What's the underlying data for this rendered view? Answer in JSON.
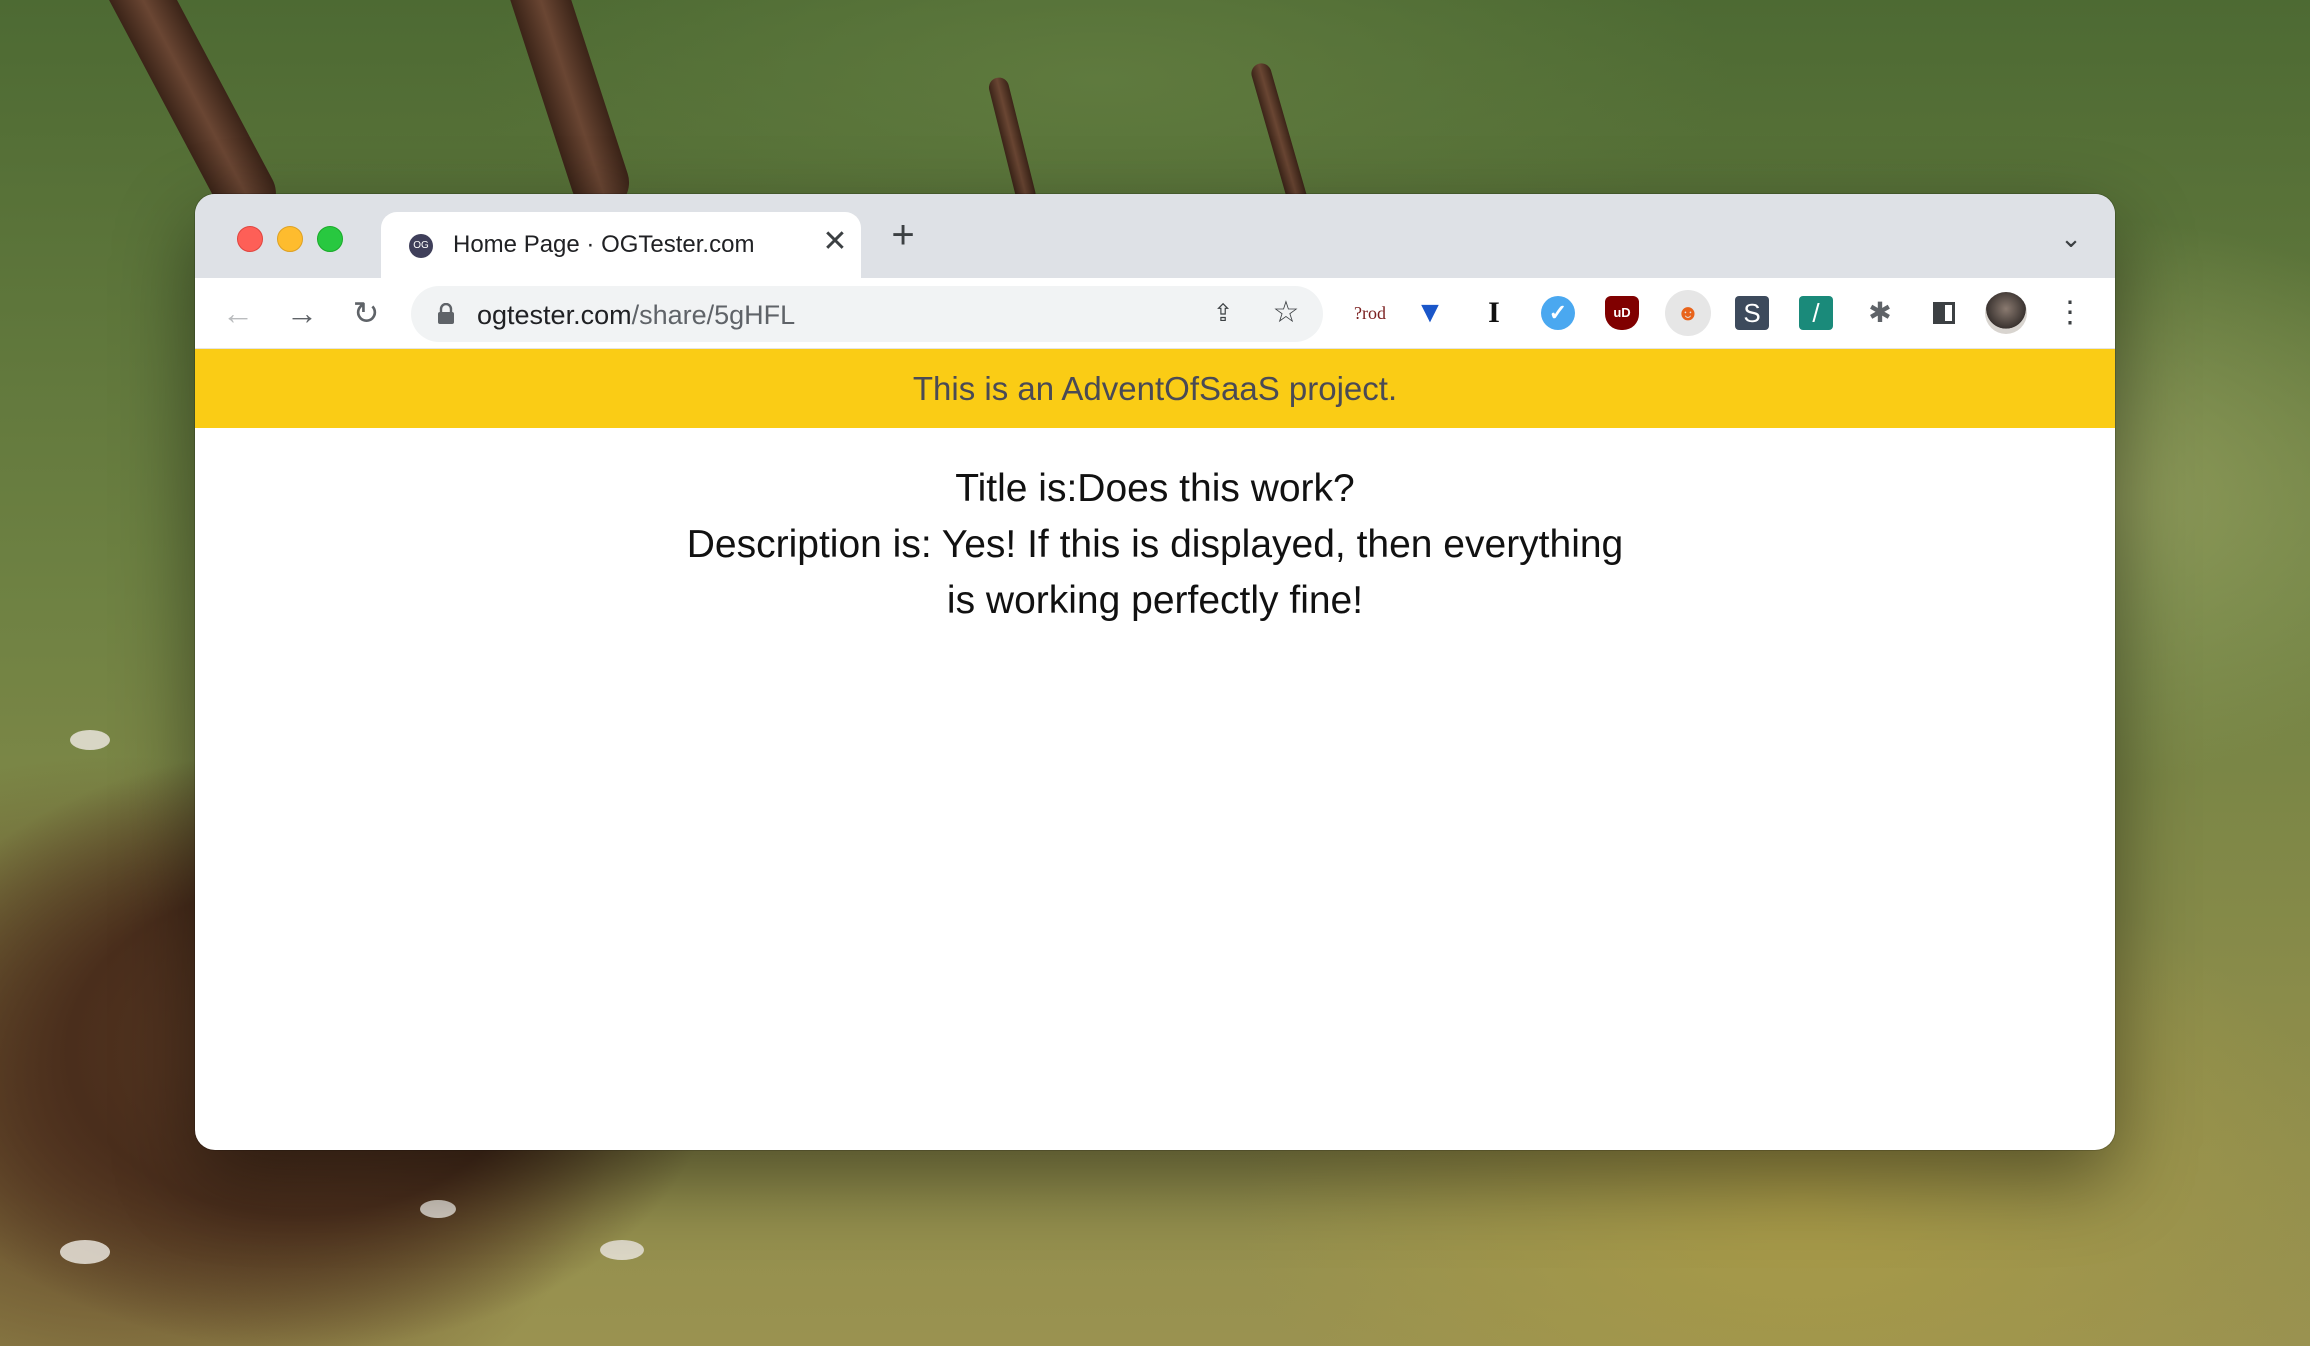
{
  "tab": {
    "favicon": "OG",
    "title": "Home Page · OGTester.com",
    "close": "✕"
  },
  "new_tab": "+",
  "tab_search": "⌄",
  "nav": {
    "back": "←",
    "forward": "→",
    "reload": "↻"
  },
  "address": {
    "domain": "ogtester.com",
    "path": "/share/5gHFL"
  },
  "omnibox_actions": {
    "share": "⇪",
    "bookmark": "☆"
  },
  "extensions": [
    {
      "name": "prod-extension-icon",
      "glyph": "?rod"
    },
    {
      "name": "gem-extension-icon",
      "glyph": "▼"
    },
    {
      "name": "i-extension-icon",
      "glyph": "I"
    },
    {
      "name": "v-extension-icon",
      "glyph": "✓"
    },
    {
      "name": "ublock-extension-icon",
      "glyph": "uD"
    },
    {
      "name": "robot-extension-icon",
      "glyph": "☻"
    },
    {
      "name": "s-extension-icon",
      "glyph": "S"
    },
    {
      "name": "slash-extension-icon",
      "glyph": "/"
    },
    {
      "name": "puzzle-extensions-icon",
      "glyph": "✱"
    }
  ],
  "menu": "⋮",
  "banner": "This is an AdventOfSaaS project.",
  "content": {
    "title_line": "Title is:Does this work?",
    "description_line": "Description is: Yes! If this is displayed, then everything is working perfectly fine!"
  },
  "colors": {
    "banner_bg": "#facc15",
    "tabstrip_bg": "#dee1e6"
  }
}
